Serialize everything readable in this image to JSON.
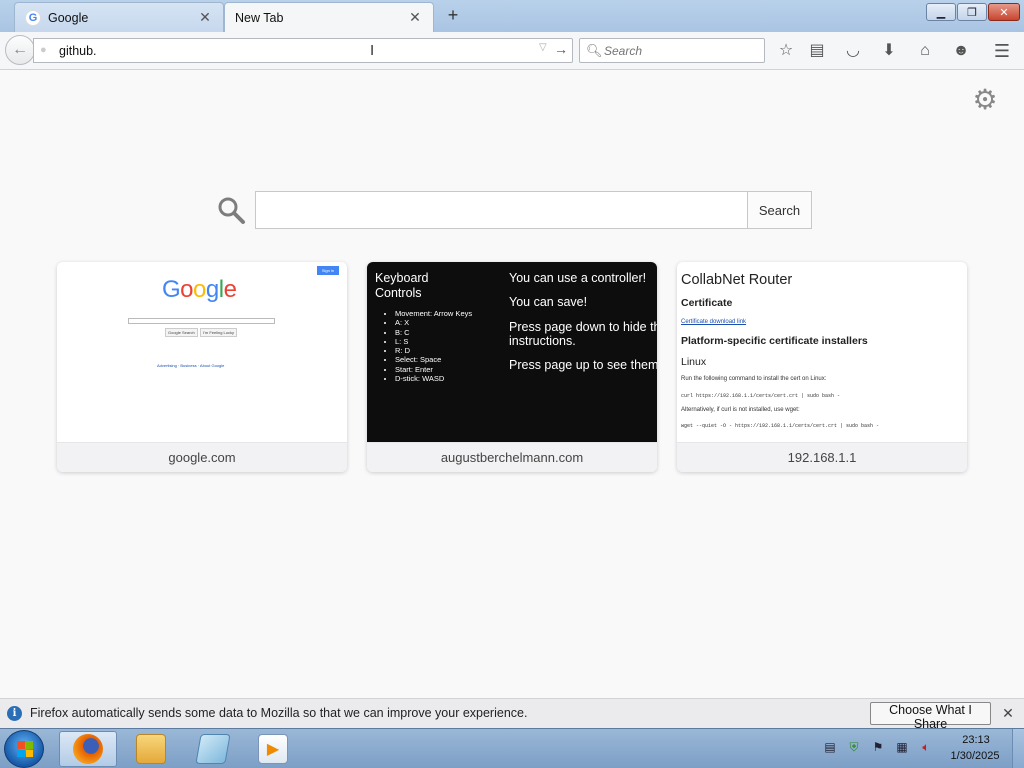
{
  "tabs": [
    {
      "title": "Google",
      "favicon": "google-icon",
      "active": false
    },
    {
      "title": "New Tab",
      "favicon": "",
      "active": true
    }
  ],
  "window_controls": {
    "minimize": "minimize-icon",
    "maximize": "maximize-icon",
    "close": "close-icon"
  },
  "navbar": {
    "url_value": "github.",
    "search_placeholder": "Search"
  },
  "toolbar_icons": [
    "bookmark-star-icon",
    "reading-list-icon",
    "pocket-icon",
    "downloads-icon",
    "home-icon",
    "hello-chat-icon",
    "menu-icon"
  ],
  "newtab": {
    "search_button": "Search",
    "tiles": [
      {
        "label": "google.com"
      },
      {
        "label": "augustberchelmann.com"
      },
      {
        "label": "192.168.1.1"
      }
    ],
    "google_thumb": {
      "logo": "Google",
      "button1": "Google Search",
      "button2": "I'm Feeling Lucky"
    },
    "august_thumb": {
      "heading": "Keyboard Controls",
      "list": [
        "Movement: Arrow Keys",
        "A: X",
        "B: C",
        "L: S",
        "R: D",
        "Select: Space",
        "Start: Enter",
        "D-stick: WASD"
      ],
      "right": [
        "You can use a controller!",
        "You can save!",
        "Press page down to hide th",
        "instructions.",
        "Press page up to see them"
      ]
    },
    "router_thumb": {
      "title": "CollabNet Router",
      "h_certificate": "Certificate",
      "link": "Certificate download link",
      "h_platform": "Platform-specific certificate installers",
      "h_linux": "Linux"
    }
  },
  "notification": {
    "text": "Firefox automatically sends some data to Mozilla so that we can improve your experience.",
    "button": "Choose What I Share"
  },
  "taskbar": {
    "apps": [
      "firefox-icon",
      "explorer-icon",
      "notepad-icon",
      "media-player-icon"
    ],
    "clock_time": "23:13",
    "clock_date": "1/30/2025"
  },
  "colors": {
    "accent_blue": "#4285f4",
    "taskbar": "#8aa8cd",
    "info_blue": "#2a6fb5"
  }
}
